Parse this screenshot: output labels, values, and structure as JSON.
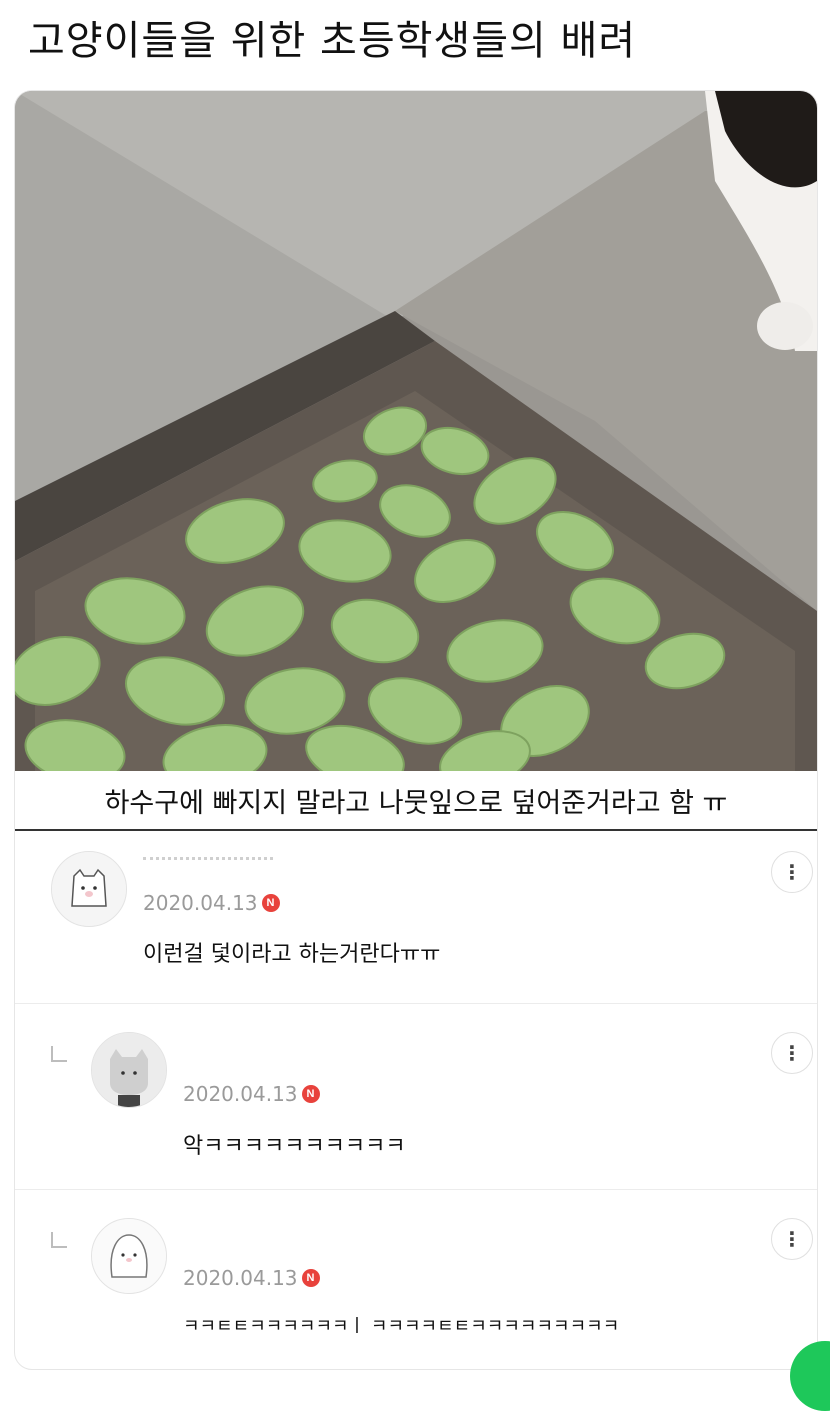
{
  "post": {
    "title": "고양이들을 위한 초등학생들의 배려",
    "caption": "하수구에 빠지지 말라고 나뭇잎으로 덮어준거라고 함 ㅠ"
  },
  "comments": [
    {
      "date": "2020.04.13",
      "badge": "N",
      "text": "이런걸 덫이라고 하는거란다ㅠㅠ",
      "more": "⋮"
    },
    {
      "date": "2020.04.13",
      "badge": "N",
      "text": "악ㅋㅋㅋㅋㅋㅋㅋㅋㅋㅋ",
      "more": "⋮"
    },
    {
      "date": "2020.04.13",
      "badge": "N",
      "text": "ㅋㅋㅌㅌㅋㅋㅋㅋㅋㅋㅣ    ㅋㅋㅋㅋㅌㅌㅋㅋㅋㅋㅋㅋㅋㅋㅋ",
      "more": "⋮"
    }
  ],
  "colors": {
    "badge": "#e8423c",
    "accent": "#1ec85a"
  }
}
